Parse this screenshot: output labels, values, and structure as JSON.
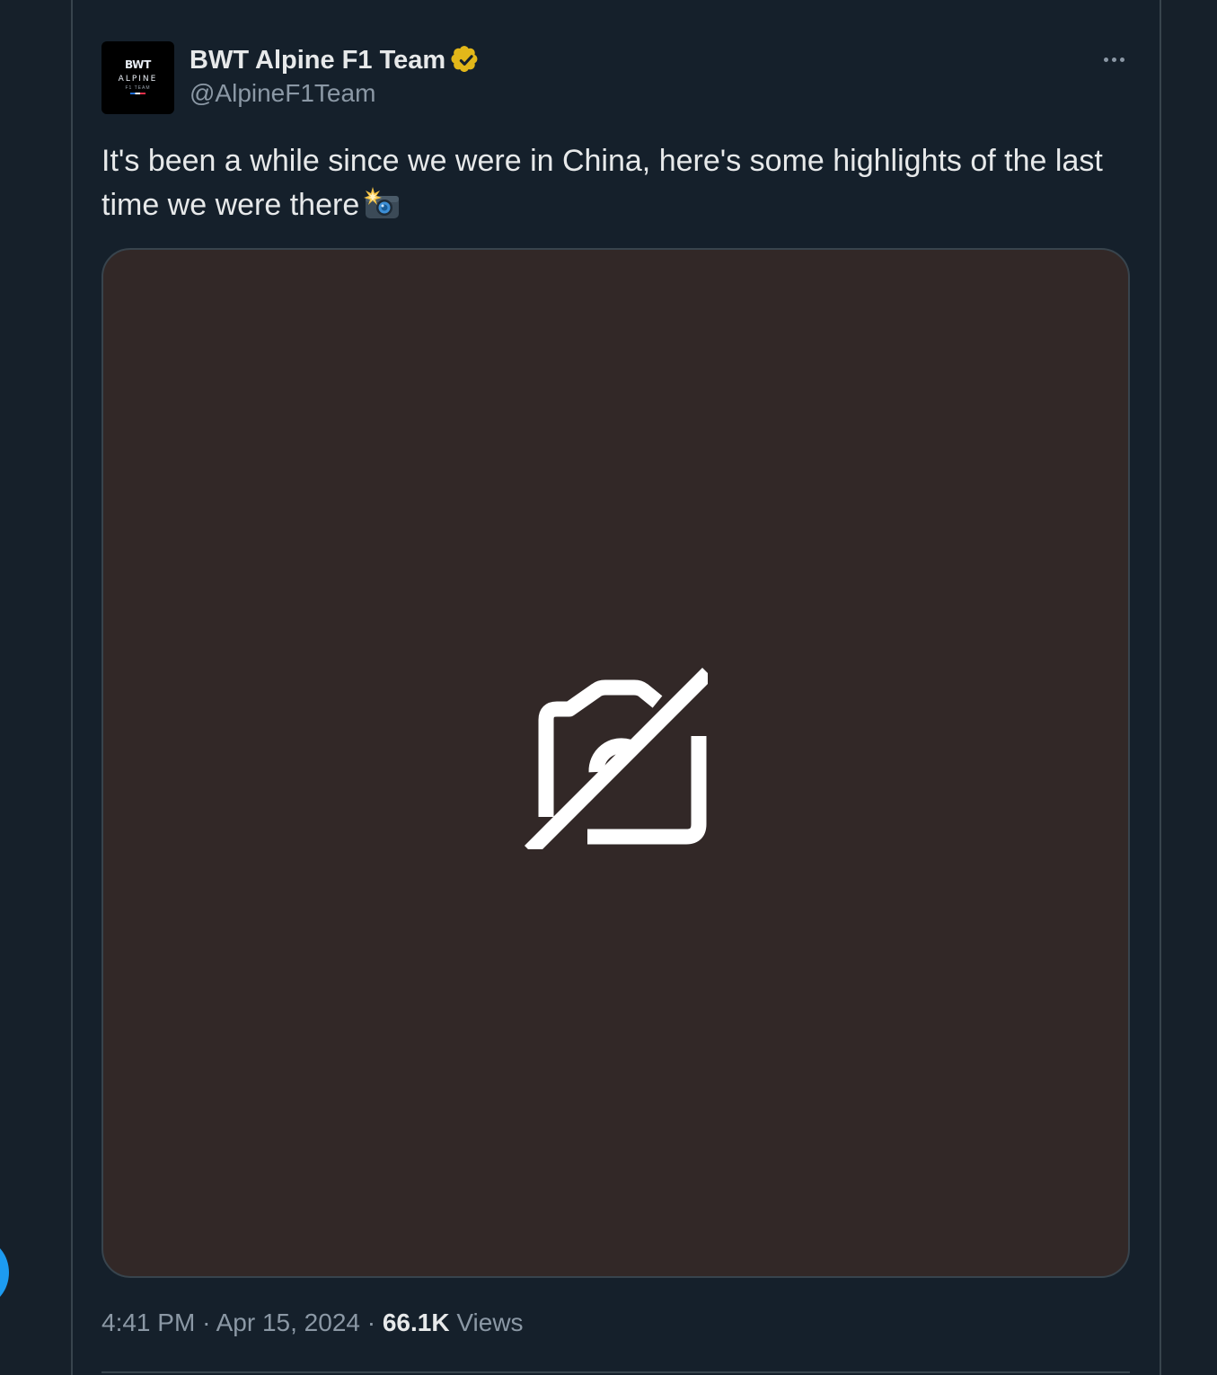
{
  "tweet": {
    "author": {
      "display_name": "BWT Alpine F1 Team",
      "handle": "@AlpineF1Team",
      "verified": true,
      "avatar_logo": {
        "brand": "BWT",
        "word": "ALPINE",
        "sub": "F1 TEAM"
      }
    },
    "text": "It's been a while since we were in China, here's some highlights of the last time we were there",
    "emoji_icon": "camera-flash-icon",
    "media_placeholder_icon": "no-image-icon",
    "time": "4:41 PM",
    "date": "Apr 15, 2024",
    "separator": "·",
    "views_count": "66.1K",
    "views_label": "Views"
  },
  "icons": {
    "more": "more-options-icon",
    "verified": "verified-badge-icon"
  },
  "colors": {
    "background": "#15202b",
    "border": "#38444d",
    "text_primary": "#e7e9ea",
    "text_secondary": "#8b98a5",
    "verified_gold": "#e2b719",
    "media_background": "#322827",
    "accent_blue": "#1d9bf0"
  }
}
